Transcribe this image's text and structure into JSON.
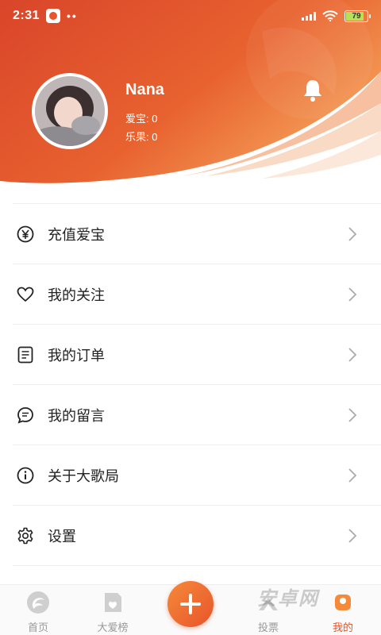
{
  "status": {
    "time": "2:31",
    "dots": "••",
    "battery": "79"
  },
  "profile": {
    "name": "Nana",
    "aibao_label": "爱宝: 0",
    "leguo_label": "乐果: 0"
  },
  "menu": {
    "items": [
      {
        "label": "充值爱宝",
        "icon": "yuan-coin-icon"
      },
      {
        "label": "我的关注",
        "icon": "heart-icon"
      },
      {
        "label": "我的订单",
        "icon": "document-icon"
      },
      {
        "label": "我的留言",
        "icon": "chat-bubble-icon"
      },
      {
        "label": "关于大歌局",
        "icon": "info-icon"
      },
      {
        "label": "设置",
        "icon": "gear-icon"
      }
    ]
  },
  "nav": {
    "home": "首页",
    "ranking": "大爱榜",
    "vote": "投票",
    "mine": "我的"
  },
  "watermark": "安卓网",
  "colors": {
    "accent": "#e8542b",
    "gradient_start": "#d9452a",
    "gradient_end": "#f5a05a"
  }
}
